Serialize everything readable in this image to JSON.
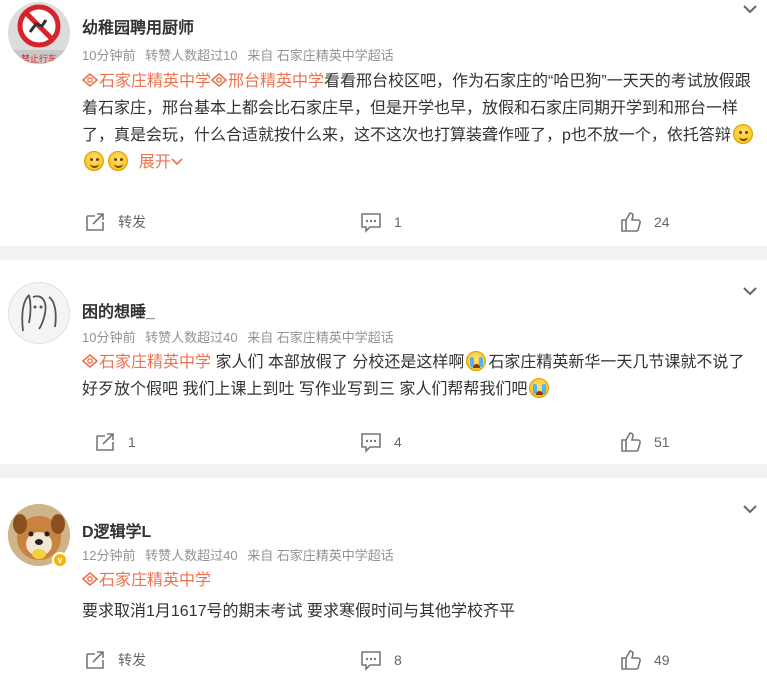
{
  "posts": [
    {
      "username": "幼稚园聘用厨师",
      "avatar_caption": "禁止行车",
      "meta": [
        "10分钟前",
        "转赞人数超过10",
        "来自 石家庄精英中学超话"
      ],
      "topics": [
        "石家庄精英中学",
        "邢台精英中学"
      ],
      "text": "看看邢台校区吧，作为石家庄的“哈巴狗”一天天的考试放假跟着石家庄，邢台基本上都会比石家庄早，但是开学也早，放假和石家庄同期开学到和邢台一样了，真是会玩，什么合适就按什么来，这不这次也打算装聋作哑了，p也不放一个，依托答辩",
      "expand_label": "展开",
      "repost_label": "转发",
      "comment_count": "1",
      "like_count": "24"
    },
    {
      "username": "困的想睡_",
      "meta": [
        "10分钟前",
        "转赞人数超过40",
        "来自 石家庄精英中学超话"
      ],
      "topics": [
        "石家庄精英中学"
      ],
      "text_a": " 家人们 本部放假了 分校还是这样啊",
      "text_b": "石家庄精英新华一天几节课就不说了 好歹放个假吧 我们上课上到吐 写作业写到三 家人们帮帮我们吧",
      "repost_count": "1",
      "comment_count": "4",
      "like_count": "51"
    },
    {
      "username": "D逻辑学L",
      "meta": [
        "12分钟前",
        "转赞人数超过40",
        "来自 石家庄精英中学超话"
      ],
      "topics": [
        "石家庄精英中学"
      ],
      "text": "要求取消1月1617号的期末考试 要求寒假时间与其他学校齐平",
      "repost_label": "转发",
      "comment_count": "8",
      "like_count": "49"
    }
  ],
  "colors": {
    "topic": "#eb7350",
    "meta": "#939393",
    "separator": "#f2f2f2",
    "verified_badge": "#f7b500"
  },
  "icons": [
    "chevron-down-icon",
    "repost-icon",
    "comment-icon",
    "like-icon",
    "topic-icon",
    "smile-emoji-icon",
    "cry-emoji-icon",
    "verified-badge-icon"
  ]
}
